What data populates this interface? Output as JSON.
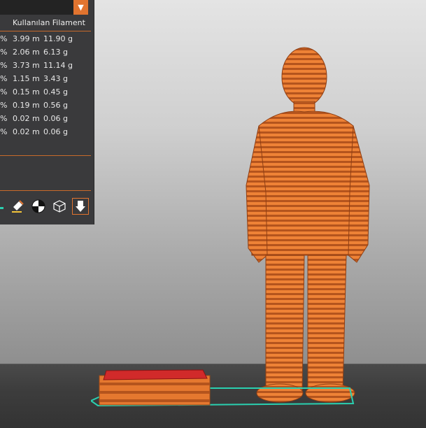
{
  "legend": {
    "header": "Kullanılan Filament",
    "rows": [
      {
        "pct": "%",
        "length": "3.99 m",
        "weight": "11.90 g"
      },
      {
        "pct": "%",
        "length": "2.06 m",
        "weight": "6.13 g"
      },
      {
        "pct": "%",
        "length": "3.73 m",
        "weight": "11.14 g"
      },
      {
        "pct": "%",
        "length": "1.15 m",
        "weight": "3.43 g"
      },
      {
        "pct": "%",
        "length": "0.15 m",
        "weight": "0.45 g"
      },
      {
        "pct": "%",
        "length": "0.19 m",
        "weight": "0.56 g"
      },
      {
        "pct": "%",
        "length": "0.02 m",
        "weight": "0.06 g"
      },
      {
        "pct": "%",
        "length": "0.02 m",
        "weight": "0.06 g"
      }
    ],
    "dropdown_glyph": "▼"
  },
  "toolbar": {
    "icons": [
      "paint-brush-icon",
      "seam-icon",
      "wireframe-cube-icon",
      "export-icon"
    ]
  },
  "colors": {
    "accent": "#e1742f",
    "model": "#e5782f",
    "panel": "#3a3a3c"
  }
}
